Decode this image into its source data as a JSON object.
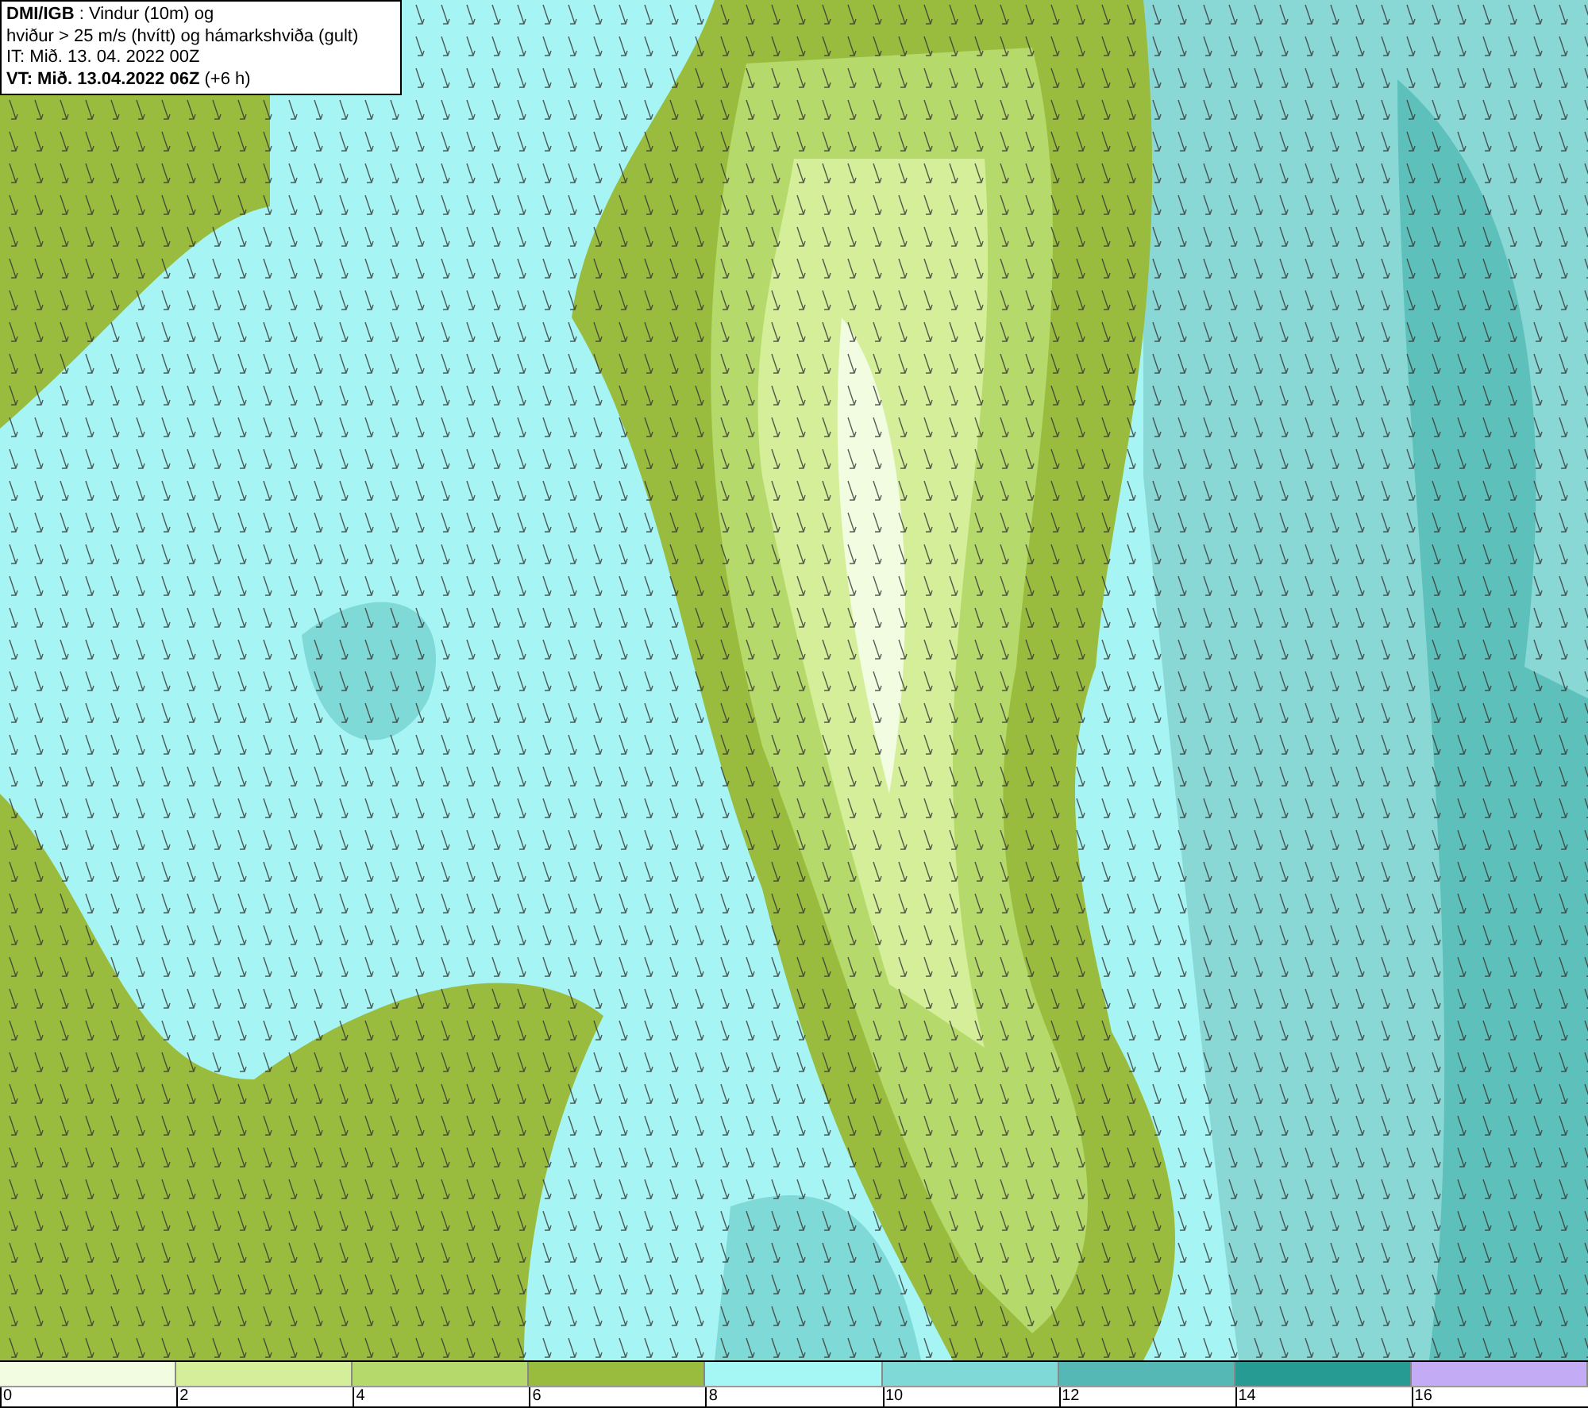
{
  "header": {
    "lines": [
      "**DMI/IGB** : Vindur (10m) og",
      "hviður > 25 m/s (hvítt) og hámarkshviða (gult)",
      "IT: Mið. 13. 04. 2022 00Z",
      "**VT: Mið. 13.04.2022 06Z** (+6 h)"
    ]
  },
  "legend": {
    "bins": [
      {
        "color": "#f2fce0"
      },
      {
        "color": "#d5ee9a"
      },
      {
        "color": "#b5d96a"
      },
      {
        "color": "#99bc3e"
      },
      {
        "color": "#a5f7f5"
      },
      {
        "color": "#7fd9d6"
      },
      {
        "color": "#55b8b5"
      },
      {
        "color": "#259b94"
      },
      {
        "color": "#c3acf5"
      }
    ],
    "ticks": [
      "0",
      "2",
      "4",
      "6",
      "8",
      "10",
      "12",
      "14",
      "16"
    ]
  }
}
